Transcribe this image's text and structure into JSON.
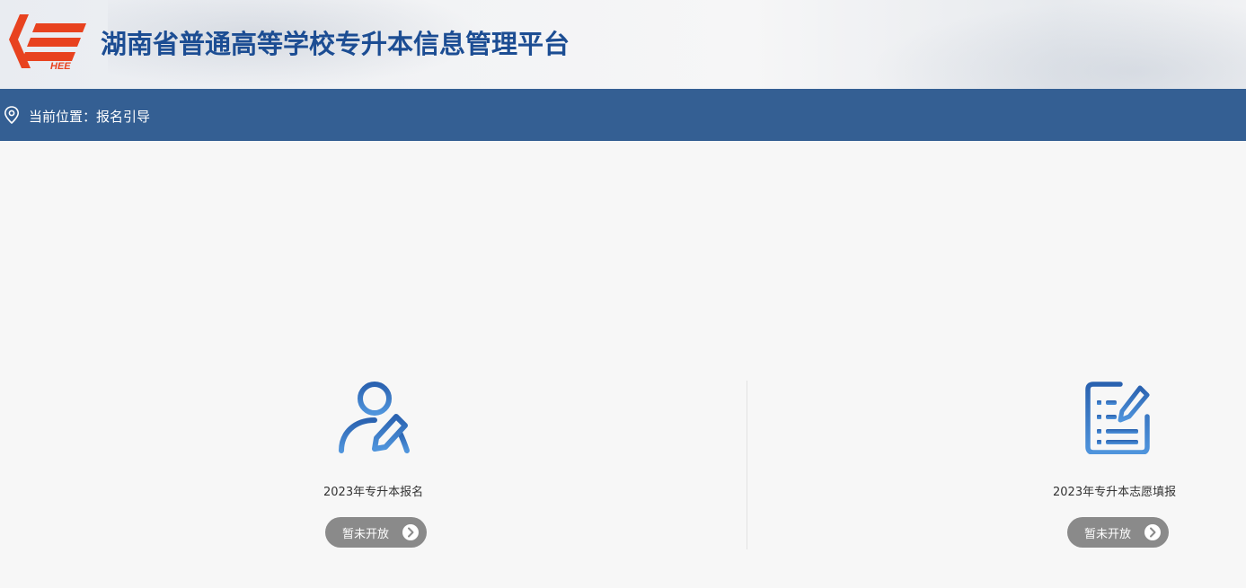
{
  "header": {
    "title": "湖南省普通高等学校专升本信息管理平台",
    "logo_text": "HEE",
    "logo_color": "#e8421f",
    "title_color": "#1c4d93"
  },
  "location_bar": {
    "icon": "location-pin-icon",
    "text": "当前位置：报名引导",
    "background": "#345f93"
  },
  "cards": [
    {
      "icon": "user-edit-icon",
      "label": "2023年专升本报名",
      "button_label": "暂未开放",
      "button_icon": "chevron-right-circle-icon"
    },
    {
      "icon": "document-edit-icon",
      "label": "2023年专升本志愿填报",
      "button_label": "暂未开放",
      "button_icon": "chevron-right-circle-icon"
    }
  ],
  "colors": {
    "accent_blue": "#3a78c3",
    "disabled_button": "#8a8a8a"
  }
}
